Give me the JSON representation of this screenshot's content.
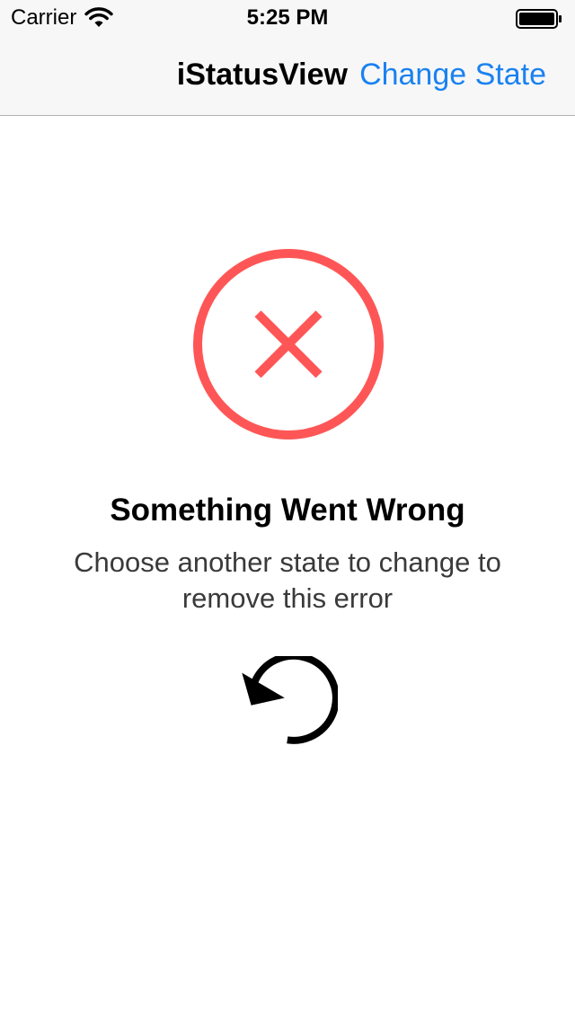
{
  "status_bar": {
    "carrier": "Carrier",
    "time": "5:25 PM",
    "wifi_icon": "wifi-icon",
    "battery_icon": "battery-full-icon"
  },
  "nav_bar": {
    "title": "iStatusView",
    "action_label": "Change State",
    "accent_color": "#1a82f0"
  },
  "error_state": {
    "icon": "error-x-circle-icon",
    "icon_color": "#fe5656",
    "title": "Something Went Wrong",
    "message": "Choose another state to change to remove this error",
    "retry_icon": "retry-icon"
  }
}
